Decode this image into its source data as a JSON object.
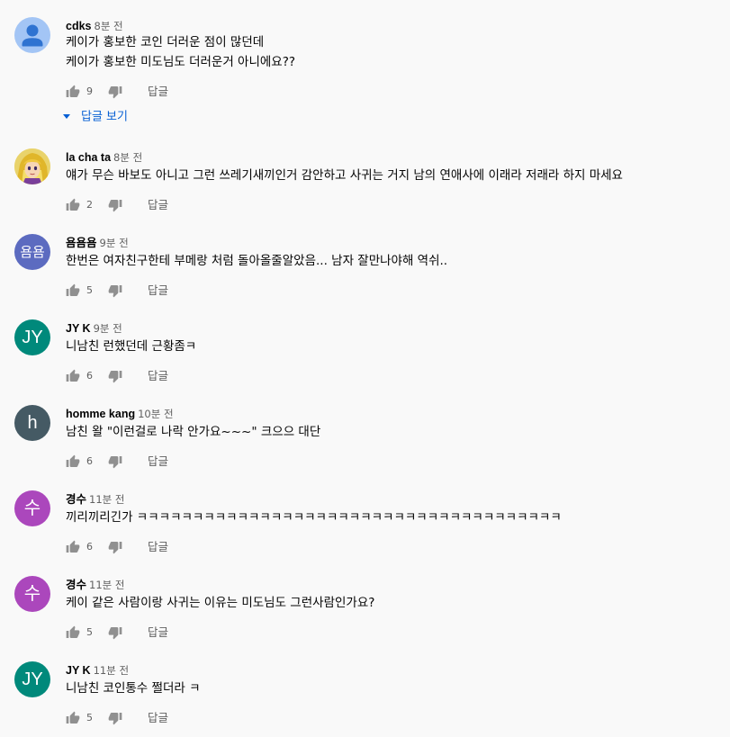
{
  "comments": [
    {
      "author": "cdks",
      "time": "8분 전",
      "lines": [
        "케이가 홍보한 코인 더러운 점이 많던데",
        "케이가 홍보한 미도님도 더러운거 아니에요??"
      ],
      "likes": "9",
      "reply_label": "답글",
      "avatar_type": "default",
      "view_replies_label": "답글 보기"
    },
    {
      "author": "la cha ta",
      "time": "8분 전",
      "lines": [
        "얘가 무슨 바보도 아니고 그런 쓰레기새끼인거 감안하고 사귀는 거지 남의 연애사에 이래라 저래라 하지 마세요"
      ],
      "likes": "2",
      "reply_label": "답글",
      "avatar_type": "photo"
    },
    {
      "author": "욤욤욤",
      "time": "9분 전",
      "lines": [
        "한번은 여자친구한테 부메랑 처럼 돌아올줄알았음... 남자 잘만나야해 역쉬.."
      ],
      "likes": "5",
      "reply_label": "답글",
      "avatar_type": "letters",
      "avatar_text": "욤욤",
      "avatar_color": "#5c6bc0"
    },
    {
      "author": "JY K",
      "time": "9분 전",
      "lines": [
        "니남친 런했던데 근황좀ㅋ"
      ],
      "likes": "6",
      "reply_label": "답글",
      "avatar_type": "letters",
      "avatar_text": "JY",
      "avatar_color": "#00897b"
    },
    {
      "author": "homme kang",
      "time": "10분 전",
      "lines": [
        "남친 왈 \"이런걸로 나락 안가요~~~\" 크으으 대단"
      ],
      "likes": "6",
      "reply_label": "답글",
      "avatar_type": "letters",
      "avatar_text": "h",
      "avatar_color": "#455a64"
    },
    {
      "author": "경수",
      "time": "11분 전",
      "lines": [
        "끼리끼리긴가 ㅋㅋㅋㅋㅋㅋㅋㅋㅋㅋㅋㅋㅋㅋㅋㅋㅋㅋㅋㅋㅋㅋㅋㅋㅋㅋㅋㅋㅋㅋㅋㅋㅋㅋㅋㅋㅋㅋ"
      ],
      "likes": "6",
      "reply_label": "답글",
      "avatar_type": "letters",
      "avatar_text": "수",
      "avatar_color": "#ab47bc"
    },
    {
      "author": "경수",
      "time": "11분 전",
      "lines": [
        "케이 같은 사람이랑 사귀는 이유는 미도님도 그런사람인가요?"
      ],
      "likes": "5",
      "reply_label": "답글",
      "avatar_type": "letters",
      "avatar_text": "수",
      "avatar_color": "#ab47bc"
    },
    {
      "author": "JY K",
      "time": "11분 전",
      "lines": [
        "니남친 코인통수 쩔더라 ㅋ"
      ],
      "likes": "5",
      "reply_label": "답글",
      "avatar_type": "letters",
      "avatar_text": "JY",
      "avatar_color": "#00897b"
    }
  ],
  "colors": {
    "background": "#f9f9f9",
    "text": "#030303",
    "secondary_text": "#606060",
    "link_blue": "#065fd4",
    "default_avatar_bg": "#a3c5f5",
    "default_avatar_fg": "#2f73d1"
  },
  "icons": {
    "like": "thumb-up-icon",
    "dislike": "thumb-down-icon",
    "expand": "caret-down-icon",
    "default_avatar": "person-icon"
  }
}
